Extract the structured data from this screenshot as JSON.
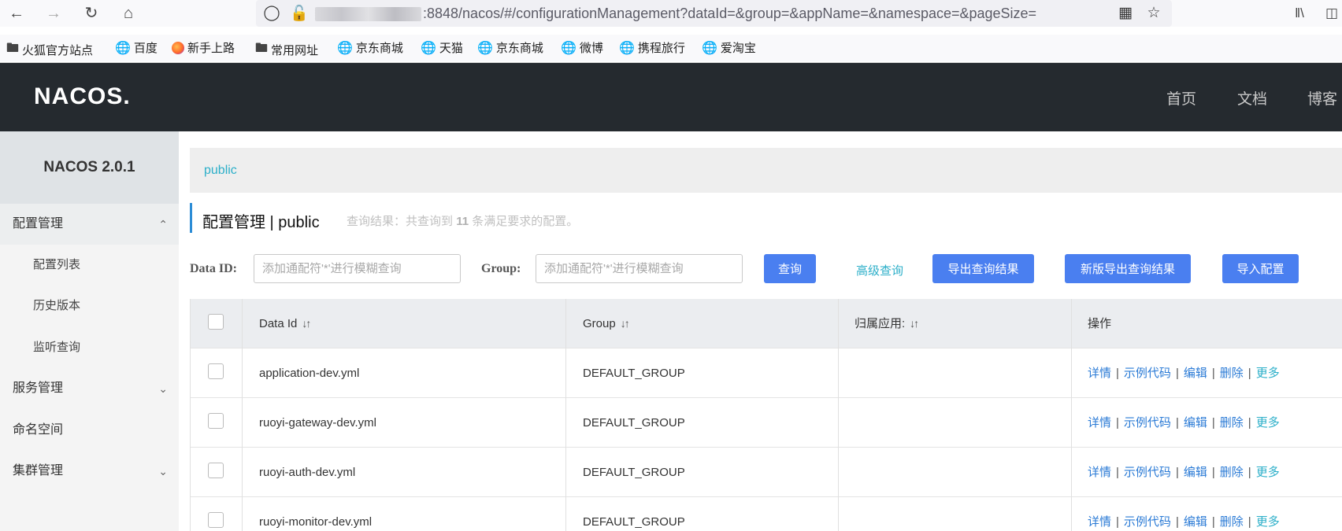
{
  "browser": {
    "url_visible": ":8848/nacos/#/configurationManagement?dataId=&group=&appName=&namespace=&pageSize=",
    "bookmarks": [
      "火狐官方站点",
      "百度",
      "新手上路",
      "常用网址",
      "京东商城",
      "天猫",
      "京东商城",
      "微博",
      "携程旅行",
      "爱淘宝"
    ]
  },
  "header": {
    "logo": "NACOS.",
    "nav": [
      "首页",
      "文档",
      "博客"
    ]
  },
  "sidebar": {
    "version": "NACOS 2.0.1",
    "items": [
      {
        "label": "配置管理",
        "level": "top",
        "expanded": true
      },
      {
        "label": "配置列表",
        "level": "sub"
      },
      {
        "label": "历史版本",
        "level": "sub"
      },
      {
        "label": "监听查询",
        "level": "sub"
      },
      {
        "label": "服务管理",
        "level": "top",
        "expanded": false
      },
      {
        "label": "命名空间",
        "level": "top"
      },
      {
        "label": "集群管理",
        "level": "top",
        "expanded": false
      }
    ]
  },
  "breadcrumb": {
    "namespace": "public"
  },
  "page": {
    "title": "配置管理  |  public",
    "hint_prefix": "查询结果：共查询到",
    "hint_count": "11",
    "hint_suffix": "条满足要求的配置。"
  },
  "filters": {
    "dataid_label": "Data ID:",
    "dataid_placeholder": "添加通配符'*'进行模糊查询",
    "group_label": "Group:",
    "group_placeholder": "添加通配符'*'进行模糊查询",
    "query_button": "查询",
    "advanced_link": "高级查询",
    "export_button": "导出查询结果",
    "new_export_button": "新版导出查询结果",
    "import_button": "导入配置"
  },
  "table": {
    "headers": {
      "data_id": "Data Id",
      "group": "Group",
      "app": "归属应用:",
      "ops": "操作"
    },
    "ops": {
      "detail": "详情",
      "sample": "示例代码",
      "edit": "编辑",
      "delete": "删除",
      "more": "更多",
      "separator": "|"
    },
    "rows": [
      {
        "data_id": "application-dev.yml",
        "group": "DEFAULT_GROUP",
        "app": ""
      },
      {
        "data_id": "ruoyi-gateway-dev.yml",
        "group": "DEFAULT_GROUP",
        "app": ""
      },
      {
        "data_id": "ruoyi-auth-dev.yml",
        "group": "DEFAULT_GROUP",
        "app": ""
      },
      {
        "data_id": "ruoyi-monitor-dev.yml",
        "group": "DEFAULT_GROUP",
        "app": ""
      }
    ]
  }
}
